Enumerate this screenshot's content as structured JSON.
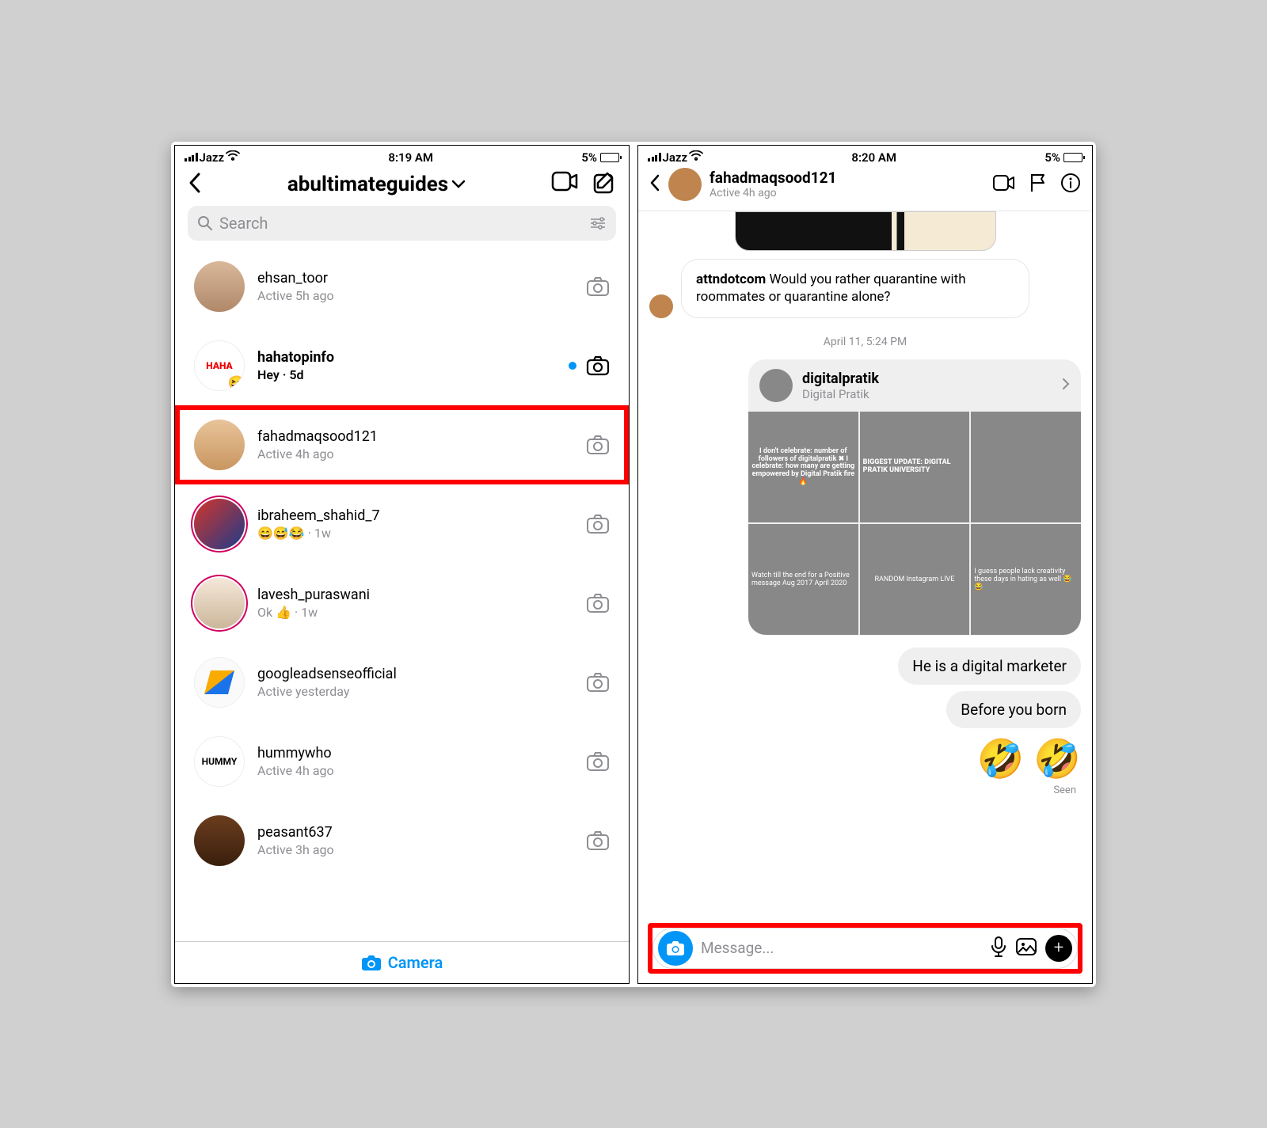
{
  "list_screen": {
    "status": {
      "carrier": "Jazz",
      "time": "8:19 AM",
      "battery": "5%"
    },
    "header": {
      "title": "abultimateguides"
    },
    "search_placeholder": "Search",
    "conversations": [
      {
        "name": "ehsan_toor",
        "sub": "Active 5h ago",
        "bold": false,
        "unread": false
      },
      {
        "name": "hahatopinfo",
        "sub": "Hey  · 5d",
        "bold": true,
        "unread": true,
        "avatarText": "HAHA"
      },
      {
        "name": "fahadmaqsood121",
        "sub": "Active 4h ago",
        "bold": false,
        "highlight": true
      },
      {
        "name": "ibraheem_shahid_7",
        "sub": "😄😅😂  · 1w",
        "bold": false,
        "ring": true
      },
      {
        "name": "lavesh_puraswani",
        "sub": "Ok 👍  · 1w",
        "bold": false,
        "ring": true
      },
      {
        "name": "googleadsenseofficial",
        "sub": "Active yesterday",
        "bold": false
      },
      {
        "name": "hummywho",
        "sub": "Active 4h ago",
        "bold": false,
        "avatarText": "HUMMY"
      },
      {
        "name": "peasant637",
        "sub": "Active 3h ago",
        "bold": false
      }
    ],
    "bottom_label": "Camera"
  },
  "chat_screen": {
    "status": {
      "carrier": "Jazz",
      "time": "8:20 AM",
      "battery": "5%"
    },
    "header": {
      "name": "fahadmaqsood121",
      "sub": "Active 4h ago"
    },
    "incoming": {
      "handle": "attndotcom",
      "text": " Would you rather quarantine with roommates or quarantine alone?"
    },
    "timestamp": "April 11, 5:24 PM",
    "profile_card": {
      "name": "digitalpratik",
      "sub": "Digital Pratik",
      "tiles": [
        "I don't celebrate: number of followers of digitalpratik ✖  I celebrate: how many are getting empowered by Digital Pratik fire 🔥",
        "BIGGEST UPDATE: DIGITAL PRATIK UNIVERSITY",
        "",
        "Watch till the end for a Positive message  Aug 2017  April 2020",
        "RANDOM Instagram LIVE",
        "I guess people lack creativity these days in hating as well 😂😂"
      ]
    },
    "outgoing": [
      "He is a digital marketer",
      "Before you born"
    ],
    "emoji": "🤣  🤣",
    "seen": "Seen",
    "input_placeholder": "Message..."
  }
}
